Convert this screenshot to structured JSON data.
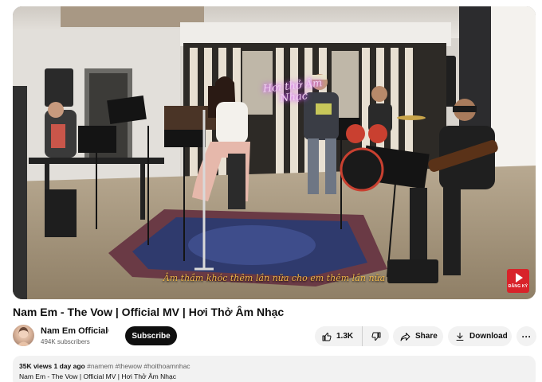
{
  "video": {
    "wall_logo": "Hơi thở Âm Nhạc",
    "subtitle": "Âm thầm khóc thêm lần nữa cho em thêm lần nữa",
    "subscribe_badge": "ĐĂNG KÝ"
  },
  "title": "Nam Em - The Vow | Official MV | Hơi Thở Âm Nhạc",
  "channel": {
    "name": "Nam Em Official",
    "verified_icon": "music-note-icon",
    "subscribers": "494K subscribers",
    "subscribe_label": "Subscribe"
  },
  "actions": {
    "likes": "1.3K",
    "share_label": "Share",
    "download_label": "Download",
    "more_label": "···"
  },
  "description": {
    "views": "35K views",
    "date": "1 day ago",
    "tags": "#namem #thewow #hoithoamnhac",
    "text": "Nam Em - The Vow | Official MV | Hơi Thở Âm Nhạc"
  },
  "colors": {
    "subscribe_bg": "#0f0f0f",
    "pill_bg": "#f2f2f2",
    "badge_red": "#d8232a",
    "subtitle": "#f2b84a"
  }
}
